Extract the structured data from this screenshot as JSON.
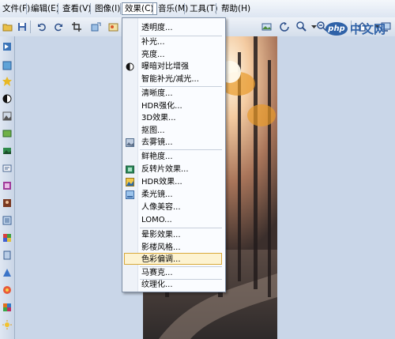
{
  "menubar": {
    "items": [
      {
        "label": "文件(F)"
      },
      {
        "label": "编辑(E)"
      },
      {
        "label": "查看(V)"
      },
      {
        "label": "图像(I)"
      },
      {
        "label": "效果(C)"
      },
      {
        "label": "音乐(M)"
      },
      {
        "label": "工具(T)"
      },
      {
        "label": "帮助(H)"
      }
    ]
  },
  "effects_menu": {
    "items": [
      {
        "label": "透明度..."
      },
      {
        "label": "补光..."
      },
      {
        "label": "亮度..."
      },
      {
        "label": "曝暗对比增强"
      },
      {
        "label": "智能补光/减光..."
      },
      {
        "label": "清晰度..."
      },
      {
        "label": "HDR强化..."
      },
      {
        "label": "3D效果..."
      },
      {
        "label": "抠图..."
      },
      {
        "label": "去雾镜..."
      },
      {
        "label": "鲜艳度..."
      },
      {
        "label": "反转片效果..."
      },
      {
        "label": "HDR效果..."
      },
      {
        "label": "柔光镜..."
      },
      {
        "label": "人像美容..."
      },
      {
        "label": "LOMO..."
      },
      {
        "label": "晕影效果..."
      },
      {
        "label": "影楼风格..."
      },
      {
        "label": "色彩偏调..."
      },
      {
        "label": "马赛克..."
      },
      {
        "label": "纹理化..."
      }
    ],
    "highlighted": "色彩偏调..."
  },
  "watermark": {
    "badge": "php",
    "text": "中文网"
  }
}
